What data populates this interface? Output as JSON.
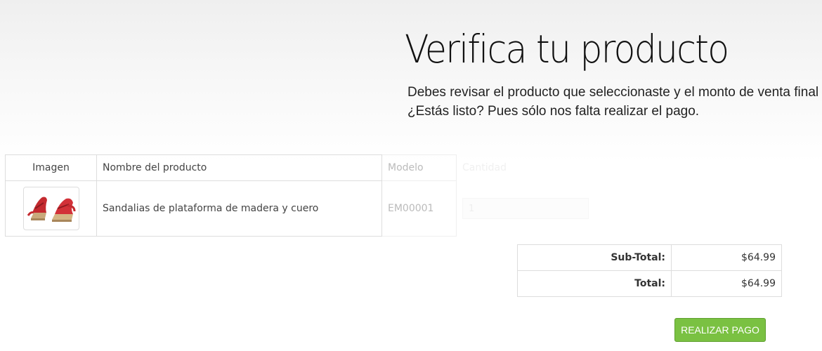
{
  "header": {
    "title": "Verifica tu producto",
    "subtitle_line1": "Debes revisar el producto que seleccionaste y el monto de venta final",
    "subtitle_line2": "¿Estás listo? Pues sólo nos falta realizar el pago."
  },
  "cart": {
    "columns": {
      "image": "Imagen",
      "name": "Nombre del producto",
      "model": "Modelo",
      "quantity": "Cantidad"
    },
    "items": [
      {
        "image_icon": "red-sandal-product-image",
        "name": "Sandalias de plataforma de madera y cuero",
        "model": "EM00001",
        "quantity": "1"
      }
    ]
  },
  "totals": {
    "subtotal_label": "Sub-Total:",
    "subtotal_value": "$64.99",
    "total_label": "Total:",
    "total_value": "$64.99"
  },
  "actions": {
    "pay_label": "REALIZAR PAGO"
  },
  "colors": {
    "pay_button": "#7ac142",
    "border": "#dddddd"
  }
}
